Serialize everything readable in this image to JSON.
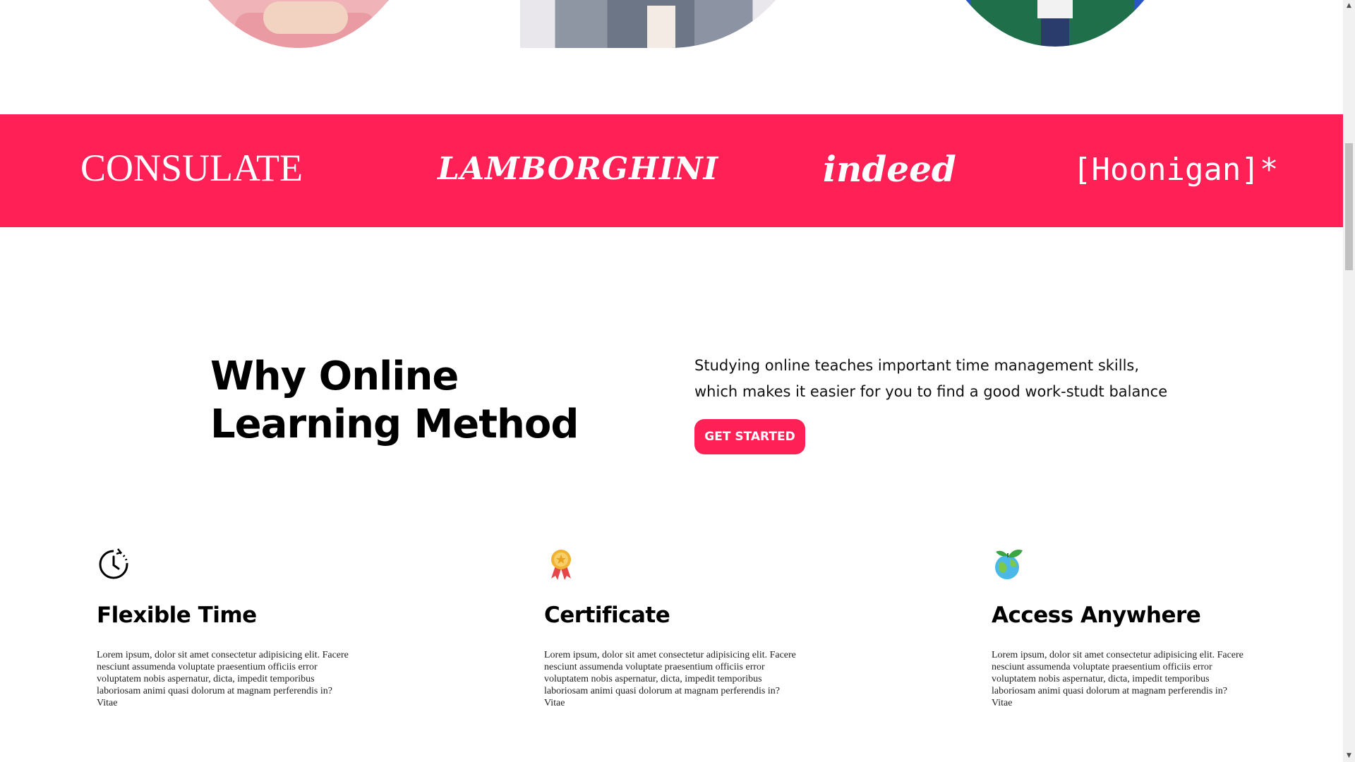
{
  "hero_photos": [
    {
      "alt": "student-holding-tablet-photo"
    },
    {
      "alt": "student-in-blazer-photo"
    },
    {
      "alt": "student-in-plaid-shirt-photo"
    }
  ],
  "logo_band": {
    "background": "#ff2156",
    "logos": [
      {
        "text": "CONSULATE"
      },
      {
        "text": "LAMBORGHINI"
      },
      {
        "text": "indeed"
      },
      {
        "text": "[Hoonigan]*"
      }
    ]
  },
  "why": {
    "title_line1": "Why Online",
    "title_line2": "Learning Method",
    "description": "Studying online teaches important time management skills, which makes it easier for you to find a good work-studt balance",
    "cta_label": "GET STARTED"
  },
  "features": [
    {
      "icon": "clock-icon",
      "title": "Flexible Time",
      "body": "Lorem ipsum, dolor sit amet consectetur adipisicing elit. Facere nesciunt assumenda voluptate praesentium officiis error voluptatem nobis aspernatur, dicta, impedit temporibus laboriosam animi quasi dolorum at magnam perferendis in? Vitae"
    },
    {
      "icon": "medal-icon",
      "title": "Certificate",
      "body": "Lorem ipsum, dolor sit amet consectetur adipisicing elit. Facere nesciunt assumenda voluptate praesentium officiis error voluptatem nobis aspernatur, dicta, impedit temporibus laboriosam animi quasi dolorum at magnam perferendis in? Vitae"
    },
    {
      "icon": "globe-leaf-icon",
      "title": "Access Anywhere",
      "body": "Lorem ipsum, dolor sit amet consectetur adipisicing elit. Facere nesciunt assumenda voluptate praesentium officiis error voluptatem nobis aspernatur, dicta, impedit temporibus laboriosam animi quasi dolorum at magnam perferendis in? Vitae"
    }
  ],
  "colors": {
    "accent": "#ff2156",
    "text": "#000000"
  },
  "scrollbar": {
    "up_icon": "scroll-up-arrow-icon",
    "down_icon": "scroll-down-arrow-icon"
  }
}
